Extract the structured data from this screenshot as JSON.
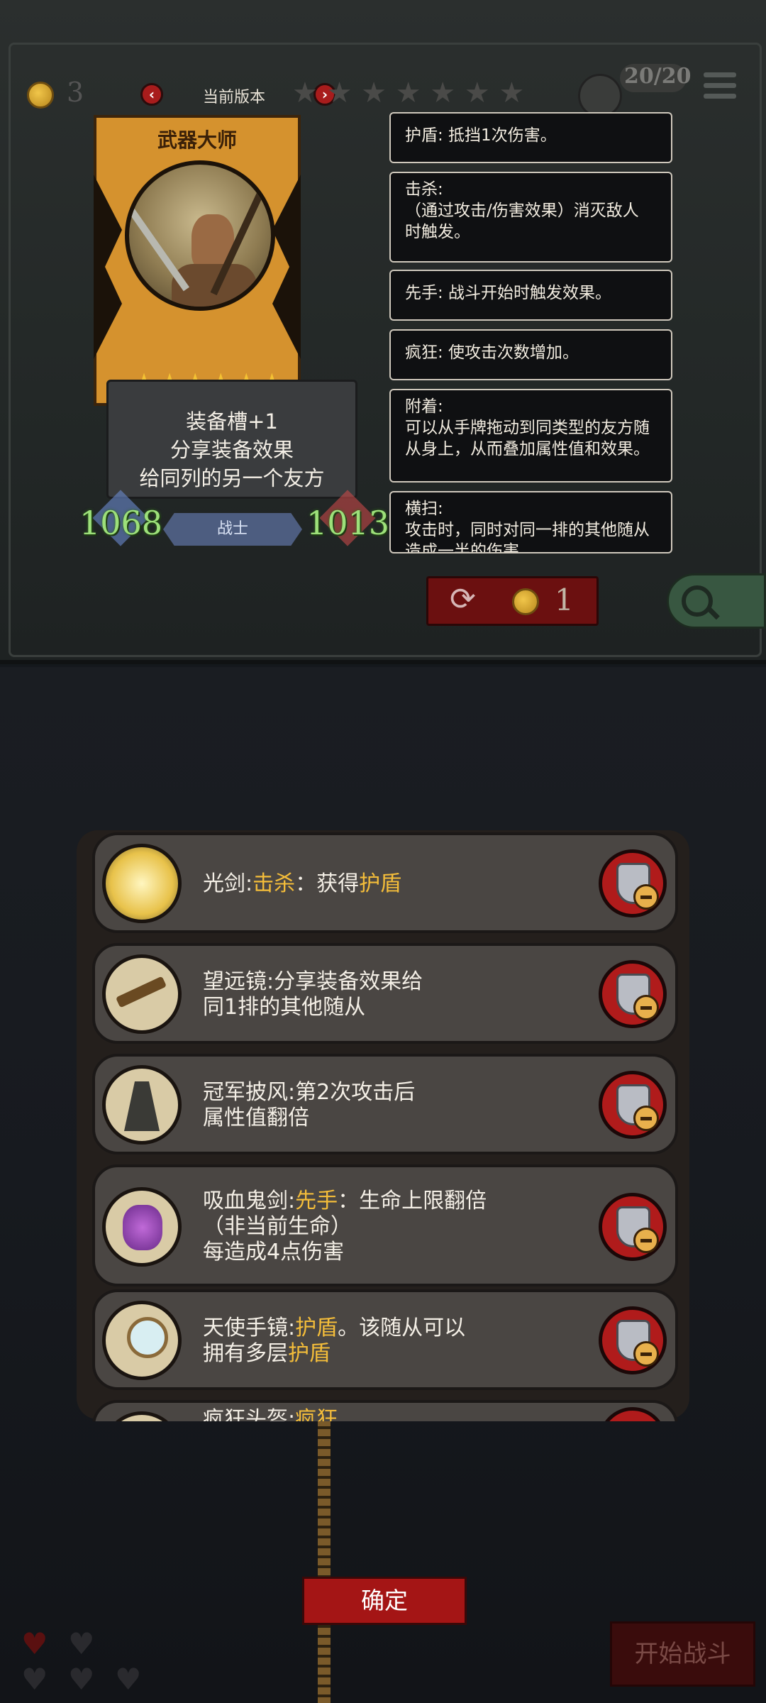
{
  "header": {
    "coins": "3",
    "version_label": "当前版本",
    "prev_icon": "chevron-left-icon",
    "next_icon": "chevron-right-icon",
    "capacity": "20/20",
    "menu_icon": "hamburger-menu-icon"
  },
  "card": {
    "name": "武器大师",
    "stars": 6,
    "star_glyphs": "★★★★★★",
    "text_lines": [
      "装备槽+1",
      "分享装备效果",
      "给同列的另一个友方"
    ],
    "attack": "1068",
    "health": "1013",
    "tribe": "战士"
  },
  "tooltips": [
    {
      "lines": [
        "护盾: 抵挡1次伤害。"
      ]
    },
    {
      "lines": [
        "击杀:",
        "（通过攻击/伤害效果）消灭敌人",
        "时触发。"
      ]
    },
    {
      "lines": [
        "先手: 战斗开始时触发效果。"
      ]
    },
    {
      "lines": [
        "疯狂: 使攻击次数增加。"
      ]
    },
    {
      "lines": [
        "附着:",
        "可以从手牌拖动到同类型的友方随",
        "从身上，从而叠加属性值和效果。"
      ]
    },
    {
      "lines": [
        "横扫:",
        "攻击时，同时对同一排的其他随从",
        "造成一半的伤害"
      ]
    }
  ],
  "reroll": {
    "icon": "refresh-icon",
    "cost": "1"
  },
  "search": {
    "icon": "search-icon"
  },
  "items": [
    {
      "icon": "light-sword-icon",
      "lines": [
        [
          {
            "t": "光剑:"
          },
          {
            "t": "击杀",
            "kw": true
          },
          {
            "t": "：获得"
          },
          {
            "t": "护盾",
            "kw": true
          }
        ]
      ]
    },
    {
      "icon": "telescope-icon",
      "lines": [
        [
          {
            "t": "望远镜:分享装备效果给"
          }
        ],
        [
          {
            "t": "同1排的其他随从"
          }
        ]
      ]
    },
    {
      "icon": "champion-cape-icon",
      "lines": [
        [
          {
            "t": "冠军披风:第2次攻击后"
          }
        ],
        [
          {
            "t": "属性值翻倍"
          }
        ]
      ]
    },
    {
      "icon": "vampire-sword-icon",
      "lines": [
        [
          {
            "t": "吸血鬼剑:"
          },
          {
            "t": "先手",
            "kw": true
          },
          {
            "t": "：生命上限翻倍"
          }
        ],
        [
          {
            "t": "（非当前生命）"
          }
        ],
        [
          {
            "t": "每造成4点伤害"
          }
        ]
      ]
    },
    {
      "icon": "angel-mirror-icon",
      "lines": [
        [
          {
            "t": "天使手镜:"
          },
          {
            "t": "护盾",
            "kw": true
          },
          {
            "t": "。该随从可以"
          }
        ],
        [
          {
            "t": "拥有多层"
          },
          {
            "t": "护盾",
            "kw": true
          }
        ]
      ]
    },
    {
      "icon": "berserk-helmet-icon",
      "lines": [
        [
          {
            "t": "疯狂头盔:"
          },
          {
            "t": "疯狂",
            "kw": true
          }
        ]
      ]
    }
  ],
  "buttons": {
    "confirm": "确定",
    "start_battle": "开始战斗"
  },
  "colors": {
    "keyword": "#f4bd3a",
    "stat_green": "#9de07a",
    "button_red": "#a41515",
    "card_gold": "#d5922e"
  }
}
